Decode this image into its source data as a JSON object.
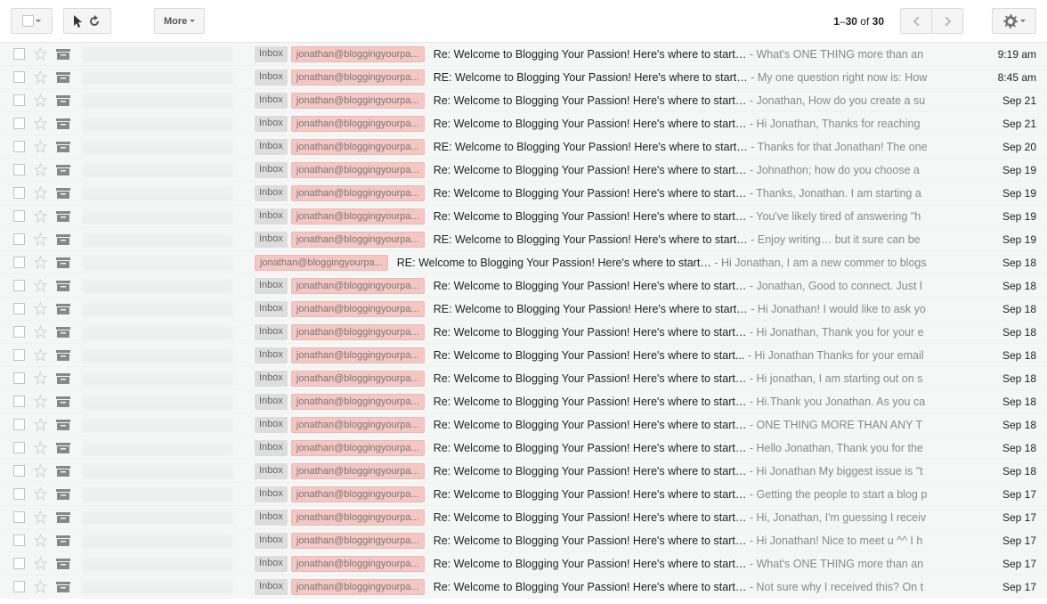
{
  "toolbar": {
    "more_label": "More",
    "page_start": "1",
    "page_end": "30",
    "page_of": "of",
    "page_total": "30"
  },
  "labels": {
    "inbox": "Inbox",
    "from": "jonathan@bloggingyourpa..."
  },
  "emails": [
    {
      "has_inbox": true,
      "prefix": "Re:",
      "subject_core": "Welcome to Blogging Your Passion! Here's where to start…",
      "snippet": "What's ONE THING more than an",
      "date": "9:19 am"
    },
    {
      "has_inbox": true,
      "prefix": "RE:",
      "subject_core": "Welcome to Blogging Your Passion! Here's where to start…",
      "snippet": "My one question right now is: How",
      "date": "8:45 am"
    },
    {
      "has_inbox": true,
      "prefix": "Re:",
      "subject_core": "Welcome to Blogging Your Passion! Here's where to start…",
      "snippet": "Jonathan, How do you create a su",
      "date": "Sep 21"
    },
    {
      "has_inbox": true,
      "prefix": "Re:",
      "subject_core": "Welcome to Blogging Your Passion! Here's where to start…",
      "snippet": "Hi Jonathan, Thanks for reaching",
      "date": "Sep 21"
    },
    {
      "has_inbox": true,
      "prefix": "RE:",
      "subject_core": "Welcome to Blogging Your Passion! Here's where to start…",
      "snippet": "Thanks for that Jonathan! The one",
      "date": "Sep 20"
    },
    {
      "has_inbox": true,
      "prefix": "Re:",
      "subject_core": "Welcome to Blogging Your Passion! Here's where to start…",
      "snippet": "Johnathon; how do you choose a",
      "date": "Sep 19"
    },
    {
      "has_inbox": true,
      "prefix": "Re:",
      "subject_core": "Welcome to Blogging Your Passion! Here's where to start…",
      "snippet": "Thanks, Jonathan. I am starting a",
      "date": "Sep 19"
    },
    {
      "has_inbox": true,
      "prefix": "Re:",
      "subject_core": "Welcome to Blogging Your Passion! Here's where to start…",
      "snippet": "You've likely tired of answering \"h",
      "date": "Sep 19"
    },
    {
      "has_inbox": true,
      "prefix": "RE:",
      "subject_core": "Welcome to Blogging Your Passion! Here's where to start…",
      "snippet": "Enjoy writing… but it sure can be",
      "date": "Sep 19"
    },
    {
      "has_inbox": false,
      "prefix": "RE:",
      "subject_core": "Welcome to Blogging Your Passion! Here's where to start…",
      "snippet": "Hi Jonathan, I am a new commer to blogs",
      "date": "Sep 18"
    },
    {
      "has_inbox": true,
      "prefix": "Re:",
      "subject_core": "Welcome to Blogging Your Passion! Here's where to start…",
      "snippet": "Jonathan, Good to connect. Just l",
      "date": "Sep 18"
    },
    {
      "has_inbox": true,
      "prefix": "RE:",
      "subject_core": "Welcome to Blogging Your Passion! Here's where to start…",
      "snippet": "Hi Jonathan! I would like to ask yo",
      "date": "Sep 18"
    },
    {
      "has_inbox": true,
      "prefix": "Re:",
      "subject_core": "Welcome to Blogging Your Passion! Here's where to start…",
      "snippet": "Hi Jonathan, Thank you for your e",
      "date": "Sep 18"
    },
    {
      "has_inbox": true,
      "prefix": "Re:",
      "subject_core": "Welcome to Blogging Your Passion! Here's where to start...",
      "snippet": "Hi Jonathan Thanks for your email",
      "date": "Sep 18"
    },
    {
      "has_inbox": true,
      "prefix": "Re:",
      "subject_core": "Welcome to Blogging Your Passion! Here's where to start…",
      "snippet": "Hi jonathan, I am starting out on s",
      "date": "Sep 18"
    },
    {
      "has_inbox": true,
      "prefix": "Re:",
      "subject_core": "Welcome to Blogging Your Passion! Here's where to start…",
      "snippet": "Hi.Thank you Jonathan. As you ca",
      "date": "Sep 18"
    },
    {
      "has_inbox": true,
      "prefix": "Re:",
      "subject_core": "Welcome to Blogging Your Passion! Here's where to start…",
      "snippet": "ONE THING MORE THAN ANY T",
      "date": "Sep 18"
    },
    {
      "has_inbox": true,
      "prefix": "Re:",
      "subject_core": "Welcome to Blogging Your Passion! Here's where to start…",
      "snippet": "Hello Jonathan, Thank you for the",
      "date": "Sep 18"
    },
    {
      "has_inbox": true,
      "prefix": "Re:",
      "subject_core": "Welcome to Blogging Your Passion! Here's where to start…",
      "snippet": "Hi Jonathan My biggest issue is \"t",
      "date": "Sep 18"
    },
    {
      "has_inbox": true,
      "prefix": "Re:",
      "subject_core": "Welcome to Blogging Your Passion! Here's where to start…",
      "snippet": "Getting the people to start a blog p",
      "date": "Sep 17"
    },
    {
      "has_inbox": true,
      "prefix": "Re:",
      "subject_core": "Welcome to Blogging Your Passion! Here's where to start…",
      "snippet": "Hi, Jonathan, I'm guessing I receiv",
      "date": "Sep 17"
    },
    {
      "has_inbox": true,
      "prefix": "Re:",
      "subject_core": "Welcome to Blogging Your Passion! Here's where to start…",
      "snippet": "Hi Jonathan! Nice to meet u ^^ I h",
      "date": "Sep 17"
    },
    {
      "has_inbox": true,
      "prefix": "Re:",
      "subject_core": "Welcome to Blogging Your Passion! Here's where to start…",
      "snippet": "What's ONE THING more than an",
      "date": "Sep 17"
    },
    {
      "has_inbox": true,
      "prefix": "Re:",
      "subject_core": "Welcome to Blogging Your Passion! Here's where to start…",
      "snippet": "Not sure why I received this? On t",
      "date": "Sep 17"
    }
  ]
}
